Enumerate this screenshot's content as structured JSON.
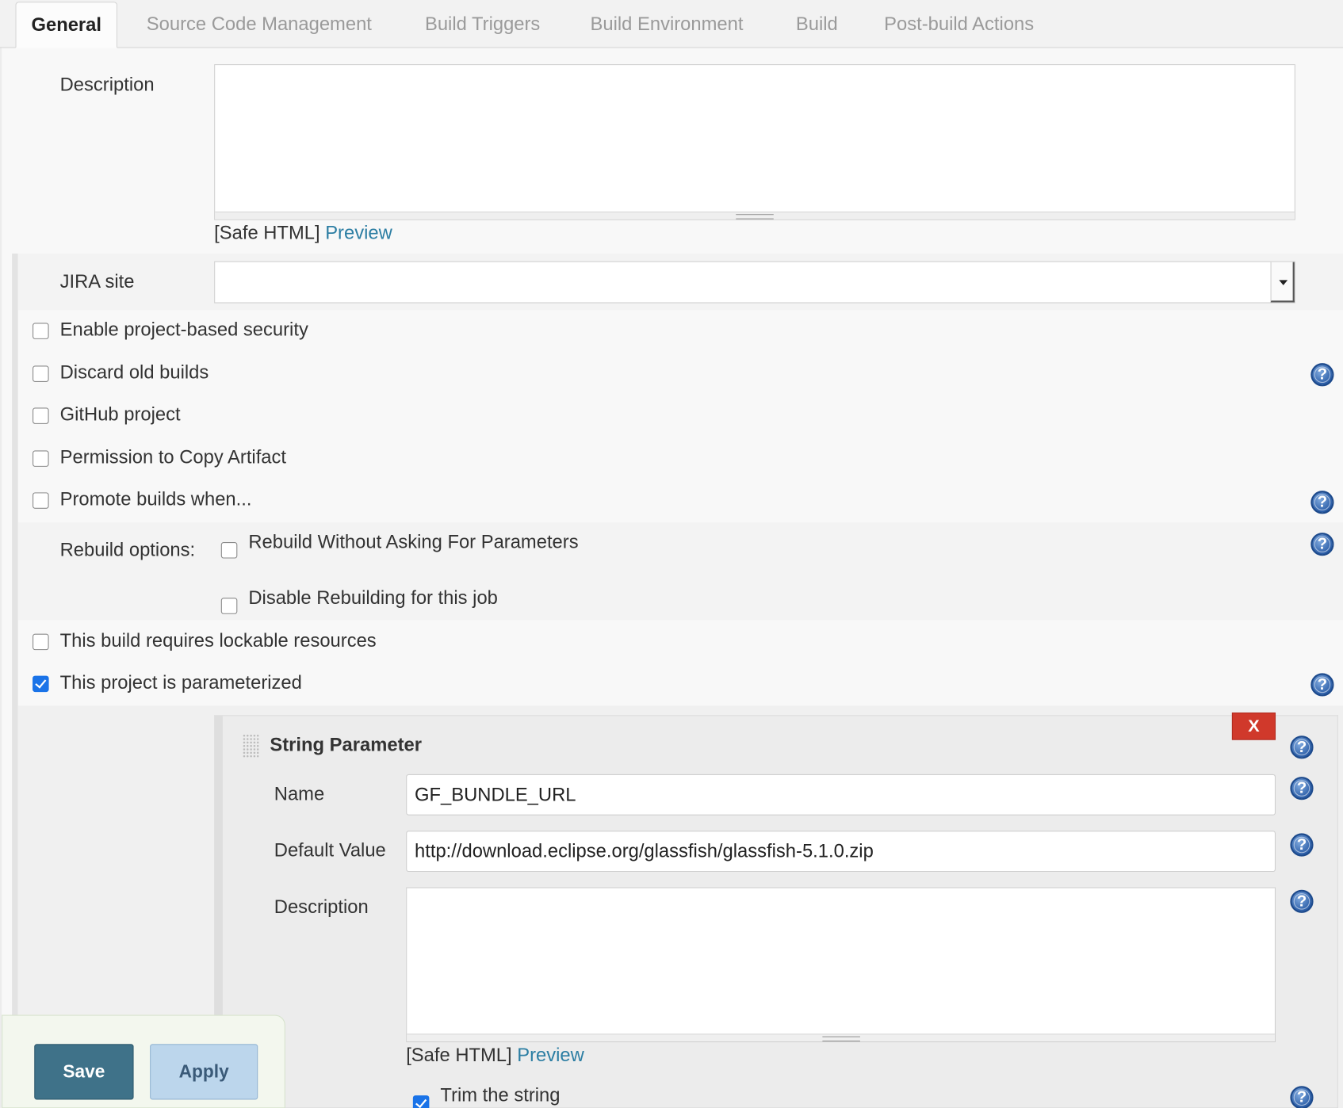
{
  "tabs": [
    {
      "label": "General",
      "active": true
    },
    {
      "label": "Source Code Management"
    },
    {
      "label": "Build Triggers"
    },
    {
      "label": "Build Environment"
    },
    {
      "label": "Build"
    },
    {
      "label": "Post-build Actions"
    }
  ],
  "description": {
    "label": "Description",
    "value": "",
    "safe_html": "[Safe HTML]",
    "preview": "Preview"
  },
  "jira": {
    "label": "JIRA site",
    "value": ""
  },
  "options": [
    {
      "label": "Enable project-based security",
      "checked": false
    },
    {
      "label": "Discard old builds",
      "checked": false
    },
    {
      "label": "GitHub project",
      "checked": false
    },
    {
      "label": "Permission to Copy Artifact",
      "checked": false
    },
    {
      "label": "Promote builds when...",
      "checked": false
    }
  ],
  "rebuild": {
    "label": "Rebuild options:",
    "without_asking": "Rebuild Without Asking For Parameters",
    "disable": "Disable Rebuilding for this job"
  },
  "lockable": {
    "label": "This build requires lockable resources",
    "checked": false
  },
  "parameterized": {
    "label": "This project is parameterized",
    "checked": true
  },
  "string_param": {
    "title": "String Parameter",
    "delete": "X",
    "name_label": "Name",
    "name_value": "GF_BUNDLE_URL",
    "default_label": "Default Value",
    "default_value": "http://download.eclipse.org/glassfish/glassfish-5.1.0.zip",
    "description_label": "Description",
    "safe_html": "[Safe HTML]",
    "preview": "Preview",
    "trim_label": "Trim the string",
    "trim_checked": true
  },
  "buttons": {
    "save": "Save",
    "apply": "Apply"
  },
  "colors": {
    "link": "#2c7ea3",
    "save": "#3f7289",
    "apply": "#bcd6ec",
    "delete": "#d0392b",
    "help": "#2d5fa8"
  }
}
